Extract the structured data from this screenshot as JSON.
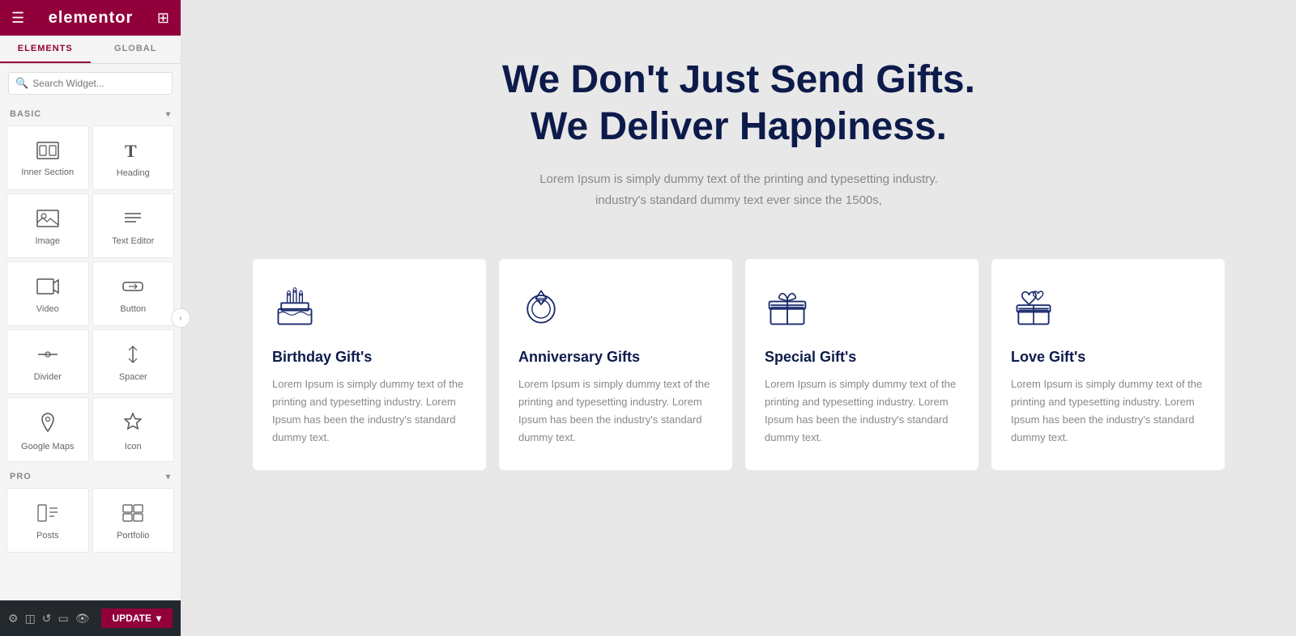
{
  "sidebar": {
    "header": {
      "logo": "elementor",
      "hamburger": "☰",
      "grid": "⊞"
    },
    "tabs": [
      {
        "id": "elements",
        "label": "ELEMENTS",
        "active": true
      },
      {
        "id": "global",
        "label": "GLOBAL",
        "active": false
      }
    ],
    "search": {
      "placeholder": "Search Widget..."
    },
    "sections": [
      {
        "id": "basic",
        "label": "BASIC",
        "widgets": [
          {
            "id": "inner-section",
            "label": "Inner Section",
            "icon": "inner-section-icon"
          },
          {
            "id": "heading",
            "label": "Heading",
            "icon": "heading-icon"
          },
          {
            "id": "image",
            "label": "Image",
            "icon": "image-icon"
          },
          {
            "id": "text-editor",
            "label": "Text Editor",
            "icon": "text-editor-icon"
          },
          {
            "id": "video",
            "label": "Video",
            "icon": "video-icon"
          },
          {
            "id": "button",
            "label": "Button",
            "icon": "button-icon"
          },
          {
            "id": "divider",
            "label": "Divider",
            "icon": "divider-icon"
          },
          {
            "id": "spacer",
            "label": "Spacer",
            "icon": "spacer-icon"
          },
          {
            "id": "google-maps",
            "label": "Google Maps",
            "icon": "google-maps-icon"
          },
          {
            "id": "icon",
            "label": "Icon",
            "icon": "icon-icon"
          }
        ]
      },
      {
        "id": "pro",
        "label": "PRO",
        "widgets": [
          {
            "id": "posts",
            "label": "Posts",
            "icon": "posts-icon"
          },
          {
            "id": "portfolio",
            "label": "Portfolio",
            "icon": "portfolio-icon"
          }
        ]
      }
    ]
  },
  "bottom_bar": {
    "update_label": "UPDATE",
    "icons": [
      "settings-icon",
      "layers-icon",
      "history-icon",
      "responsive-icon",
      "eye-icon"
    ]
  },
  "main": {
    "hero": {
      "title_line1": "We Don't Just Send Gifts.",
      "title_line2": "We Deliver Happiness.",
      "subtitle": "Lorem Ipsum is simply dummy text of the printing and typesetting industry.\nindustry's standard dummy text ever since the 1500s,"
    },
    "cards": [
      {
        "id": "birthday",
        "title": "Birthday Gift's",
        "text": "Lorem Ipsum is simply dummy text of the printing and typesetting industry. Lorem Ipsum has been the industry's standard dummy text.",
        "icon": "birthday-icon"
      },
      {
        "id": "anniversary",
        "title": "Anniversary Gifts",
        "text": "Lorem Ipsum is simply dummy text of the printing and typesetting industry. Lorem Ipsum has been the industry's standard dummy text.",
        "icon": "anniversary-icon"
      },
      {
        "id": "special",
        "title": "Special Gift's",
        "text": "Lorem Ipsum is simply dummy text of the printing and typesetting industry. Lorem Ipsum has been the industry's standard dummy text.",
        "icon": "special-icon"
      },
      {
        "id": "love",
        "title": "Love Gift's",
        "text": "Lorem Ipsum is simply dummy text of the printing and typesetting industry. Lorem Ipsum has been the industry's standard dummy text.",
        "icon": "love-icon"
      }
    ]
  },
  "colors": {
    "brand": "#92003b",
    "dark_navy": "#0d1b4b",
    "text_gray": "#888888",
    "sidebar_bg": "#f5f5f5",
    "card_bg": "#ffffff"
  }
}
